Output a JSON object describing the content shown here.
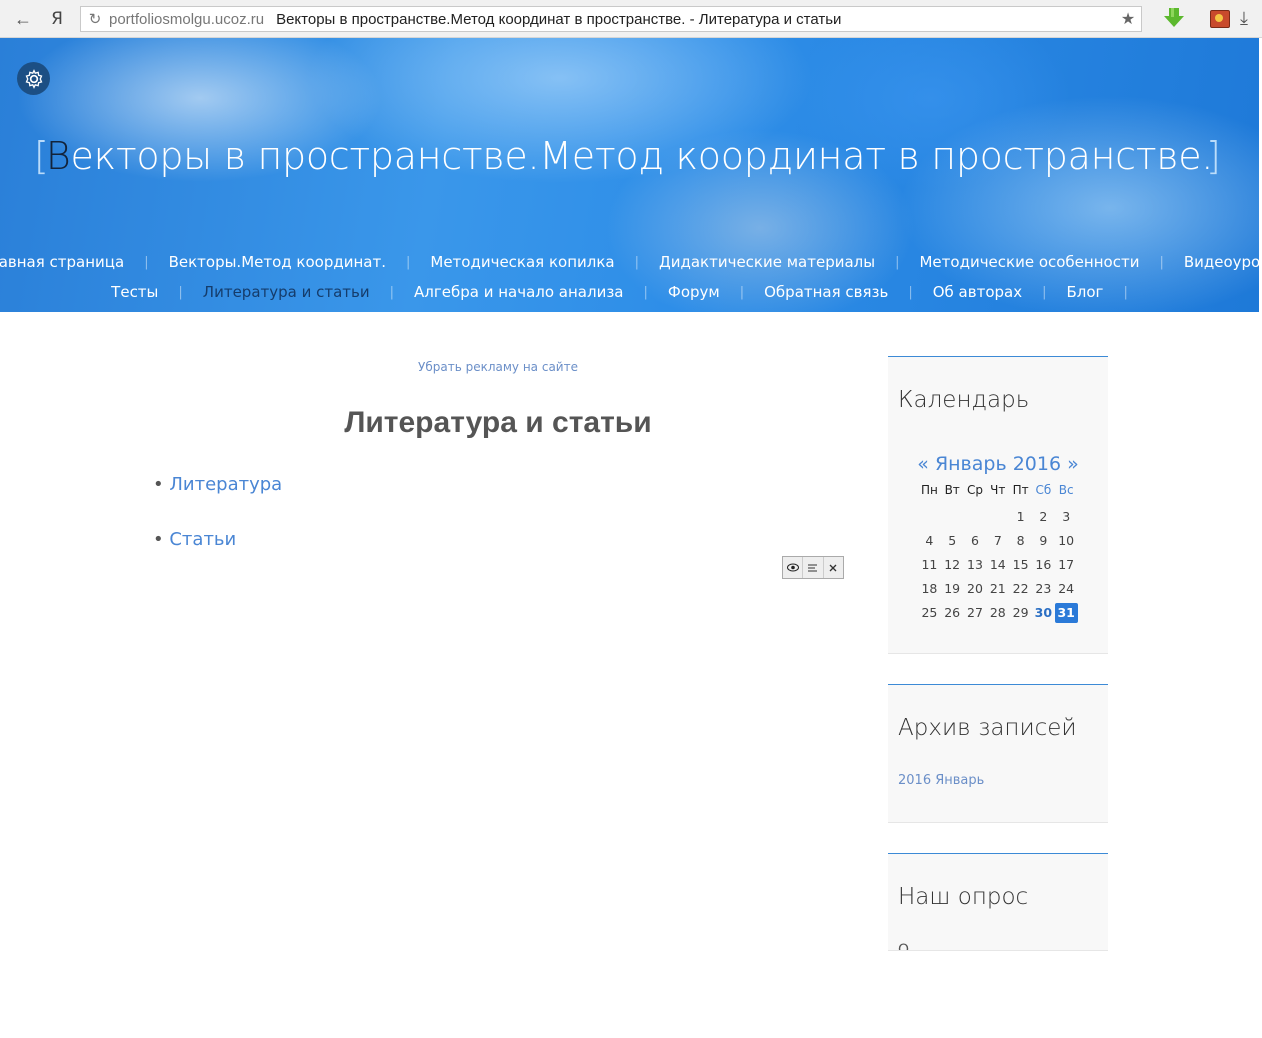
{
  "browser": {
    "back_icon": "arrow-left-icon",
    "yandex_label": "Я",
    "url_domain": "portfoliosmolgu.ucoz.ru",
    "tab_title": "Векторы в пространстве.Метод координат в пространстве. - Литература и статьи"
  },
  "header": {
    "title_first": "В",
    "title_rest": "екторы в пространстве.Метод координат в пространстве.",
    "bracket_left": "[",
    "bracket_right": "]",
    "menu_row1": [
      "Главная страница",
      "Векторы.Метод координат.",
      "Методическая копилка",
      "Дидактические материалы",
      "Методические особенности",
      "Видеоуроки"
    ],
    "menu_row2": [
      "Тесты",
      "Литература и статьи",
      "Алгебра и начало анализа",
      "Форум",
      "Обратная связь",
      "Об авторах",
      "Блог"
    ],
    "active_item": "Литература и статьи"
  },
  "main": {
    "ad_link": "Убрать рекламу на сайте",
    "page_title": "Литература и статьи",
    "items": [
      {
        "bullet": "•",
        "label": "Литература"
      },
      {
        "bullet": "•",
        "label": "Статьи"
      }
    ]
  },
  "sidebar": {
    "calendar": {
      "title": "Календарь",
      "prev": "«",
      "month": "Январь 2016",
      "next": "»",
      "weekdays": [
        "Пн",
        "Вт",
        "Ср",
        "Чт",
        "Пт",
        "Сб",
        "Вс"
      ],
      "weeks": [
        [
          "",
          "",
          "",
          "",
          "1",
          "2",
          "3"
        ],
        [
          "4",
          "5",
          "6",
          "7",
          "8",
          "9",
          "10"
        ],
        [
          "11",
          "12",
          "13",
          "14",
          "15",
          "16",
          "17"
        ],
        [
          "18",
          "19",
          "20",
          "21",
          "22",
          "23",
          "24"
        ],
        [
          "25",
          "26",
          "27",
          "28",
          "29",
          "30",
          "31"
        ]
      ],
      "linked_days": [
        "30"
      ],
      "today": "31"
    },
    "archive": {
      "title": "Архив записей",
      "link": "2016 Январь"
    },
    "poll": {
      "title": "Наш опрос",
      "cut_text": "О..."
    }
  },
  "colors": {
    "accent": "#2b7ad8",
    "link": "#4a86d4"
  }
}
